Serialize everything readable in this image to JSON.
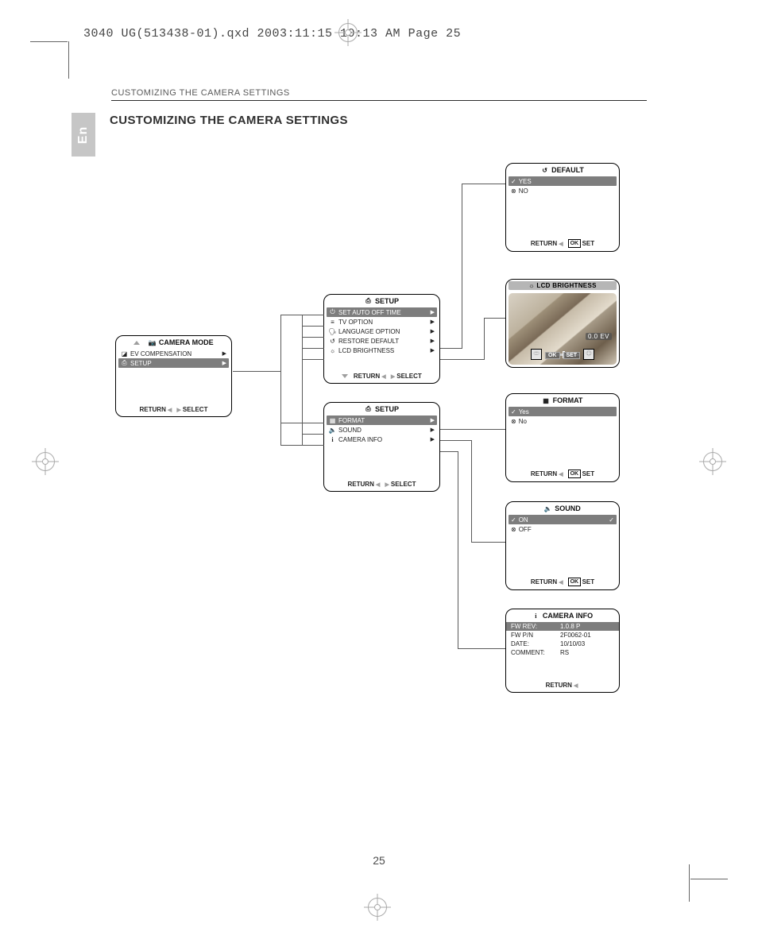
{
  "header_qxd": "3040 UG(513438-01).qxd  2003:11:15  10:13 AM  Page 25",
  "breadcrumb": "CUSTOMIZING THE CAMERA SETTINGS",
  "lang_tab": "En",
  "title": "CUSTOMIZING THE CAMERA SETTINGS",
  "page_number": "25",
  "camera_mode": {
    "header_icon": "📷",
    "title": "CAMERA MODE",
    "items": [
      {
        "icon": "◪",
        "label": "EV COMPENSATION",
        "sel": false
      },
      {
        "icon": "⎙",
        "label": "SETUP",
        "sel": true
      }
    ],
    "footer_return": "RETURN",
    "footer_select": "SELECT"
  },
  "setup1": {
    "title": "SETUP",
    "items": [
      {
        "icon": "⏻",
        "label": "SET AUTO OFF TIME",
        "sel": true
      },
      {
        "icon": "≡",
        "label": "TV OPTION",
        "sel": false
      },
      {
        "icon": "🗣",
        "label": "LANGUAGE OPTION",
        "sel": false
      },
      {
        "icon": "↺",
        "label": "RESTORE DEFAULT",
        "sel": false
      },
      {
        "icon": "☼",
        "label": "LCD BRIGHTNESS",
        "sel": false
      }
    ],
    "footer_return": "RETURN",
    "footer_select": "SELECT"
  },
  "setup2": {
    "title": "SETUP",
    "items": [
      {
        "icon": "▦",
        "label": "FORMAT",
        "sel": true
      },
      {
        "icon": "🔈",
        "label": "SOUND",
        "sel": false
      },
      {
        "icon": "i",
        "label": "CAMERA INFO",
        "sel": false
      }
    ],
    "footer_return": "RETURN",
    "footer_select": "SELECT"
  },
  "default_panel": {
    "title": "DEFAULT",
    "yes": "YES",
    "no": "NO",
    "footer_return": "RETURN",
    "footer_set": "SET"
  },
  "lcd_panel": {
    "title": "LCD BRIGHTNESS",
    "ev_value": "0.0  EV",
    "ok": "OK",
    "set": "SET"
  },
  "format_panel": {
    "title": "FORMAT",
    "yes": "Yes",
    "no": "No",
    "footer_return": "RETURN",
    "footer_set": "SET"
  },
  "sound_panel": {
    "title": "SOUND",
    "on": "ON",
    "off": "OFF",
    "footer_return": "RETURN",
    "footer_set": "SET"
  },
  "info_panel": {
    "title": "CAMERA  INFO",
    "rows": [
      {
        "label": "FW REV:",
        "value": "1.0.8  P",
        "sel": true
      },
      {
        "label": "FW  P/N",
        "value": "2F0062-01",
        "sel": false
      },
      {
        "label": "DATE:",
        "value": "10/10/03",
        "sel": false
      },
      {
        "label": "COMMENT:",
        "value": "RS",
        "sel": false
      }
    ],
    "footer_return": "RETURN"
  }
}
